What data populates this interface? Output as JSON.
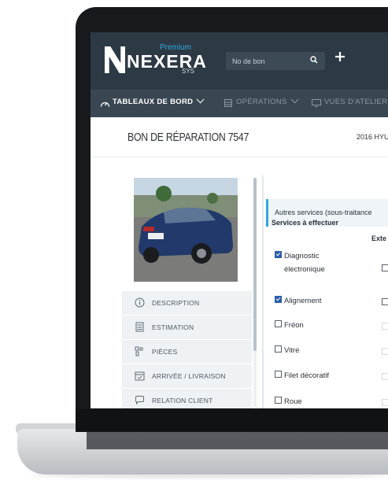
{
  "app": {
    "logo": {
      "name": "NEXERA",
      "tier": "Premium",
      "suffix": "SYS"
    },
    "search": {
      "placeholder": "No de bon"
    }
  },
  "nav": {
    "items": [
      {
        "label": "Tableaux de bord",
        "active": true
      },
      {
        "label": "Opérations",
        "active": false
      },
      {
        "label": "Vues d'atelier",
        "active": false
      }
    ]
  },
  "page": {
    "title": "BON DE RÉPARATION 7547",
    "vehicle": "2016 HYU"
  },
  "sidebar": {
    "items": [
      {
        "label": "Description",
        "icon": "info-icon"
      },
      {
        "label": "Estimation",
        "icon": "calculator-icon"
      },
      {
        "label": "Pièces",
        "icon": "parts-icon"
      },
      {
        "label": "Arrivée / Livraison",
        "icon": "calendar-check-icon"
      },
      {
        "label": "Relation client",
        "icon": "chat-icon"
      }
    ]
  },
  "panel": {
    "section_title": "Autres services (sous-traitance",
    "services_header": "Services à effectuer",
    "external_header": "Exte",
    "services": [
      {
        "label_line1": "Diagnostic",
        "label_line2": "électronique",
        "checked": true
      },
      {
        "label_line1": "Alignement",
        "checked": true
      },
      {
        "label_line1": "Fréon",
        "checked": false
      },
      {
        "label_line1": "Vitre",
        "checked": false
      },
      {
        "label_line1": "Filet décoratif",
        "checked": false
      },
      {
        "label_line1": "Roue",
        "checked": false
      }
    ]
  },
  "colors": {
    "header_bg": "#2d3a45",
    "nav_bg": "#3a4753",
    "accent": "#2ea7e0",
    "checkbox_checked": "#2a5ea8"
  }
}
